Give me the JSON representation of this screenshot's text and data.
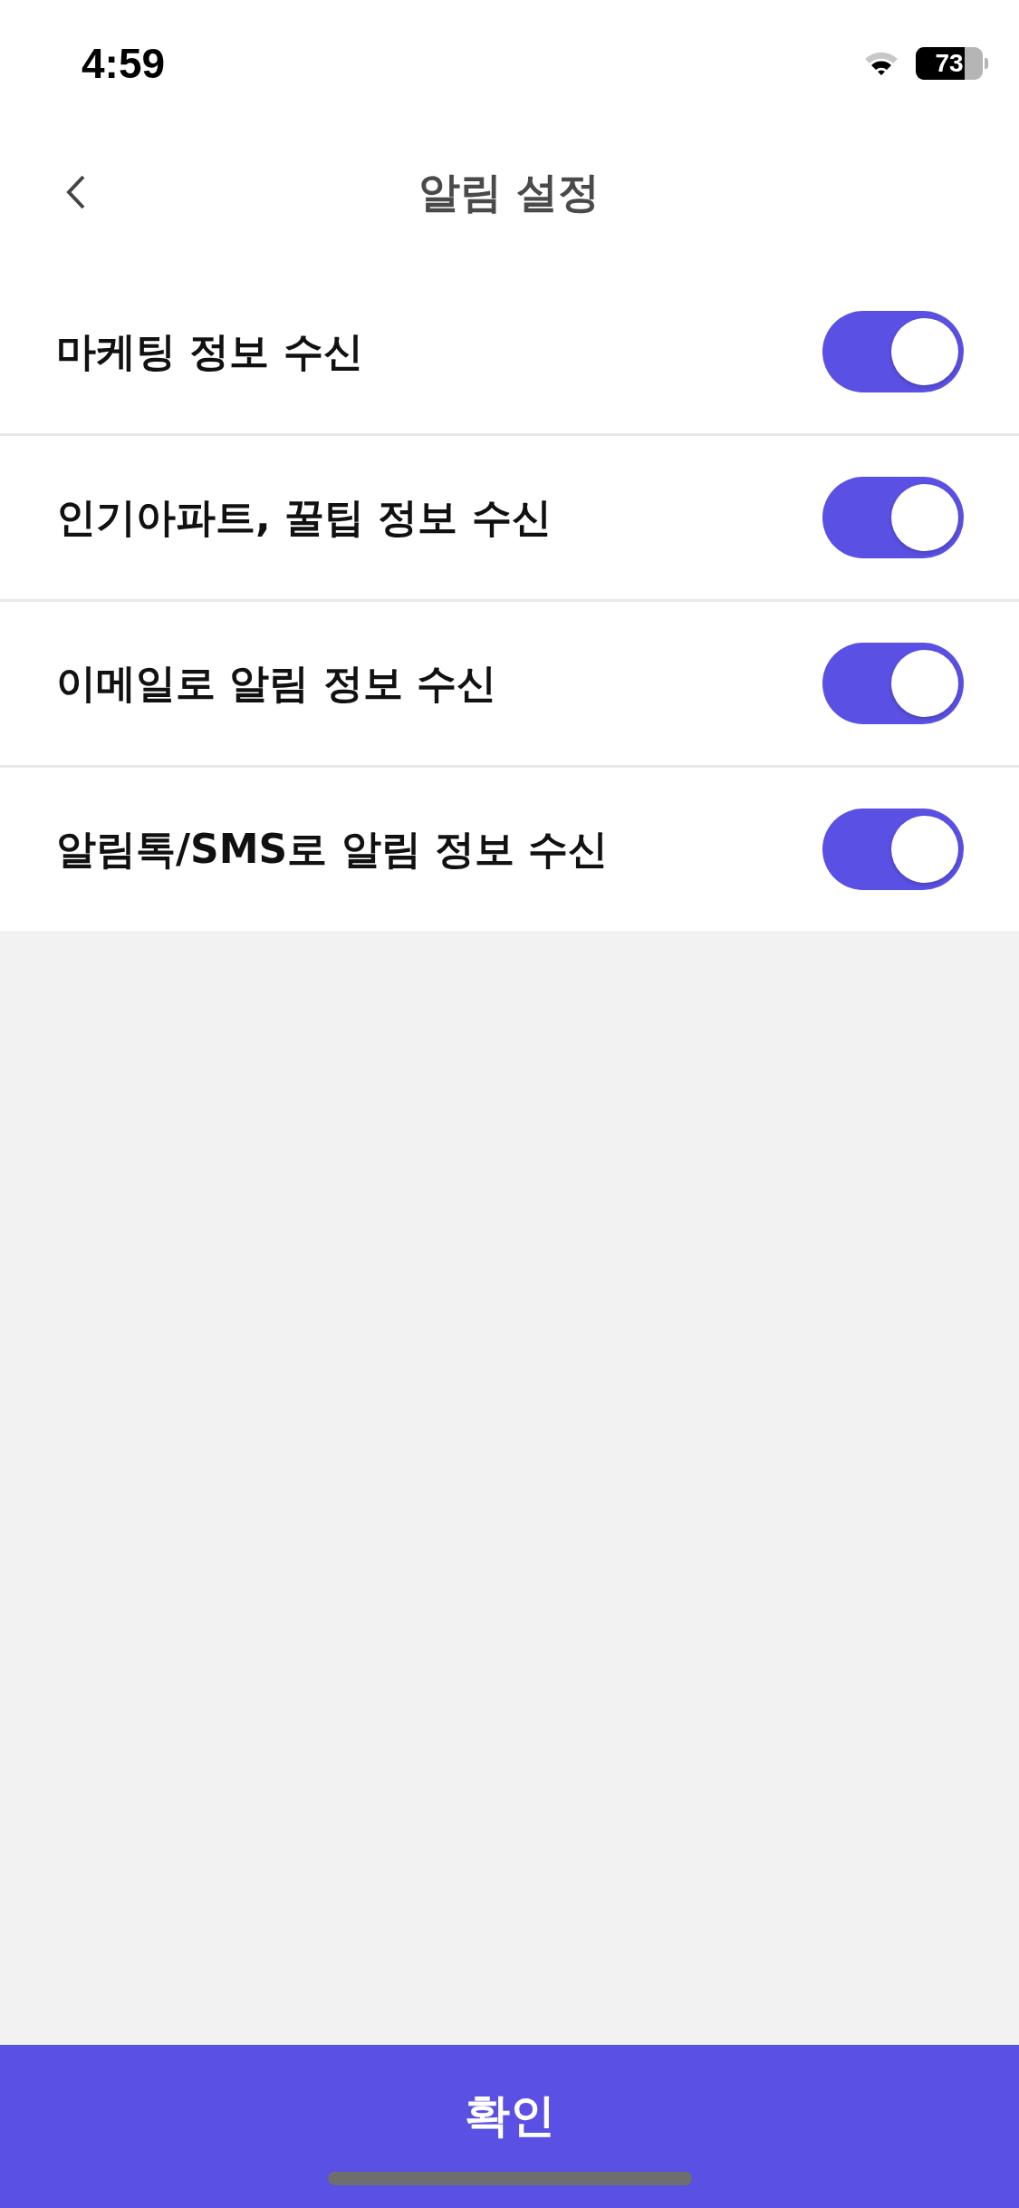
{
  "status_bar": {
    "time": "4:59",
    "battery": "73"
  },
  "header": {
    "title": "알림 설정"
  },
  "settings": [
    {
      "label": "마케팅 정보 수신",
      "on": true
    },
    {
      "label": "인기아파트, 꿀팁 정보 수신",
      "on": true
    },
    {
      "label": "이메일로 알림 정보 수신",
      "on": true
    },
    {
      "label": "알림톡/SMS로 알림 정보 수신",
      "on": true
    }
  ],
  "confirm_button": "확인"
}
